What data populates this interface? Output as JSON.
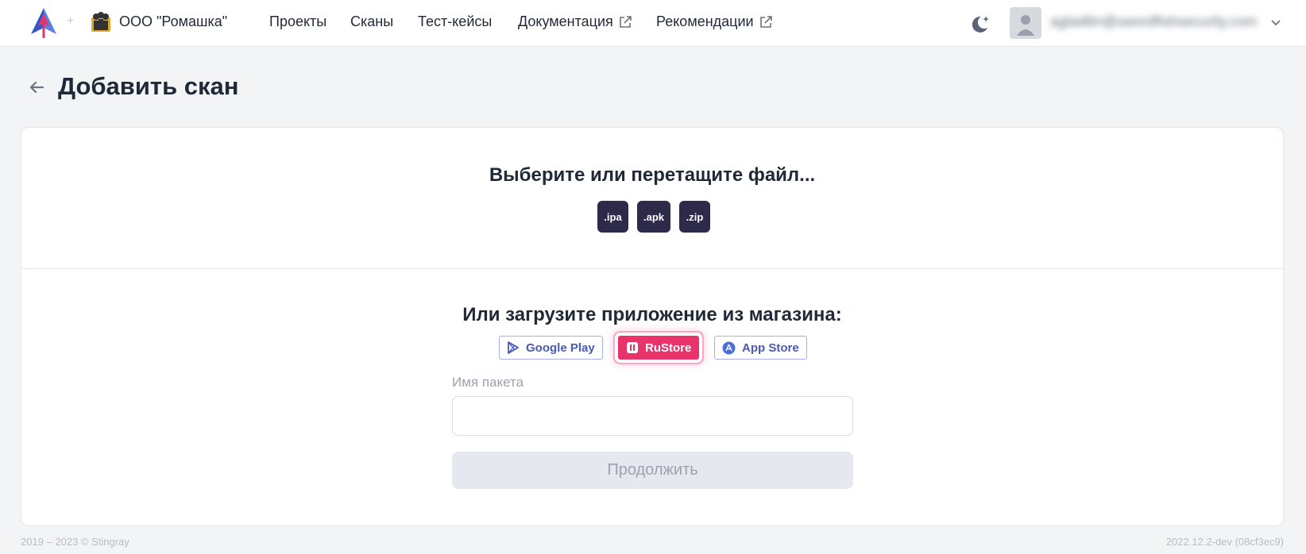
{
  "header": {
    "plus": "+",
    "org_name": "ООО \"Ромашка\"",
    "nav": [
      {
        "label": "Проекты",
        "external": false
      },
      {
        "label": "Сканы",
        "external": false
      },
      {
        "label": "Тест-кейсы",
        "external": false
      },
      {
        "label": "Документация",
        "external": true
      },
      {
        "label": "Рекомендации",
        "external": true
      }
    ],
    "user_email": "agladilin@swordfishsecurity.com"
  },
  "page": {
    "title": "Добавить скан"
  },
  "upload": {
    "title": "Выберите или перетащите файл...",
    "extensions": [
      ".ipa",
      ".apk",
      ".zip"
    ]
  },
  "store": {
    "title": "Или загрузите приложение из магазина:",
    "buttons": [
      {
        "label": "Google Play",
        "icon": "google-play-icon",
        "active": false
      },
      {
        "label": "RuStore",
        "icon": "rustore-icon",
        "active": true
      },
      {
        "label": "App Store",
        "icon": "app-store-icon",
        "active": false
      }
    ],
    "package_label": "Имя пакета",
    "package_value": "",
    "package_placeholder": "",
    "continue_label": "Продолжить"
  },
  "footer": {
    "copyright": "2019 – 2023 © Stingray",
    "version": "2022.12.2-dev (08cf3ec9)"
  },
  "colors": {
    "accent_pink": "#e8336b",
    "chip_dark": "#2d2a4a",
    "store_blue": "#4a5ab5"
  }
}
